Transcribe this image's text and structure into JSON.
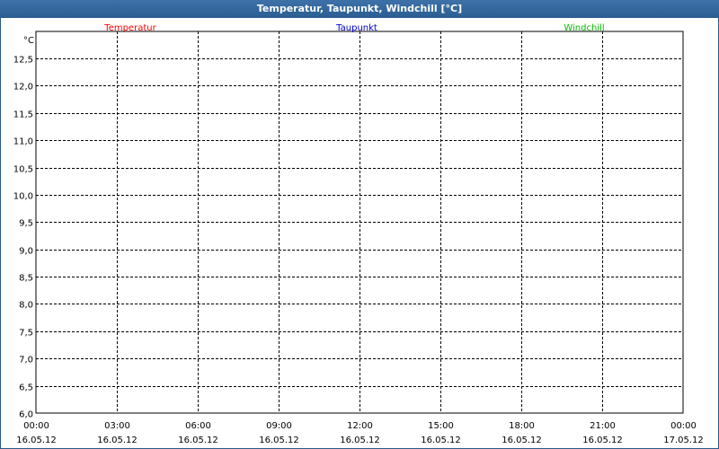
{
  "window": {
    "title": "Temperatur, Taupunkt, Windchill [°C]"
  },
  "chart_data": {
    "type": "line",
    "title": "Temperatur, Taupunkt, Windchill [°C]",
    "ylabel": "°C",
    "ylim": [
      6.0,
      12.5
    ],
    "yticks": [
      "12,5",
      "12,0",
      "11,5",
      "11,0",
      "10,5",
      "10,0",
      "9,5",
      "9,0",
      "8,5",
      "8,0",
      "7,5",
      "7,0",
      "6,5",
      "6,0"
    ],
    "x_ticks": [
      {
        "time": "00:00",
        "date": "16.05.12"
      },
      {
        "time": "03:00",
        "date": "16.05.12"
      },
      {
        "time": "06:00",
        "date": "16.05.12"
      },
      {
        "time": "09:00",
        "date": "16.05.12"
      },
      {
        "time": "12:00",
        "date": "16.05.12"
      },
      {
        "time": "15:00",
        "date": "16.05.12"
      },
      {
        "time": "18:00",
        "date": "16.05.12"
      },
      {
        "time": "21:00",
        "date": "16.05.12"
      },
      {
        "time": "00:00",
        "date": "17.05.12"
      }
    ],
    "grid": true,
    "legend_position": "top",
    "series": [
      {
        "name": "Temperatur",
        "color": "#ff0000",
        "values": []
      },
      {
        "name": "Taupunkt",
        "color": "#0000cc",
        "values": []
      },
      {
        "name": "Windchill",
        "color": "#00bb00",
        "values": []
      }
    ]
  }
}
